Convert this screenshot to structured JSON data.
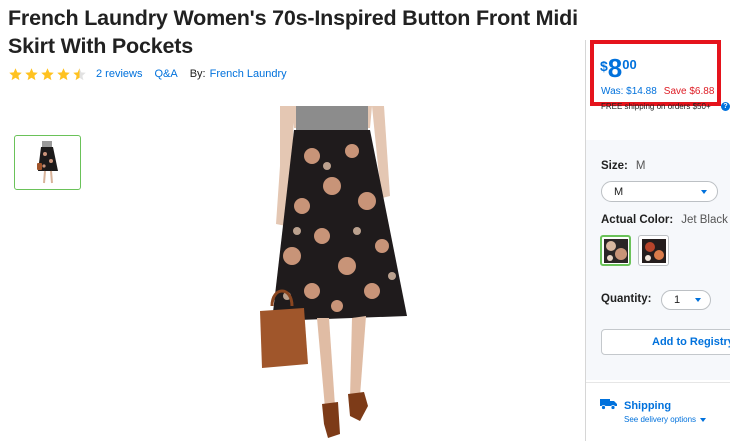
{
  "product": {
    "title": "French Laundry Women's 70s-Inspired Button Front Midi Skirt With Pockets",
    "rating": 4.5,
    "reviews_link": "2 reviews",
    "qa_link": "Q&A",
    "by_label": "By:",
    "brand_link": "French Laundry"
  },
  "price": {
    "currency": "$",
    "whole": "8",
    "cents": "00",
    "was": "Was: $14.88",
    "save": "Save $6.88",
    "free_shipping": "FREE shipping on orders $50+",
    "info_icon": "?"
  },
  "options": {
    "size_label": "Size:",
    "size_value": "M",
    "size_selected": "M",
    "color_label": "Actual Color:",
    "color_value": "Jet Black F",
    "quantity_label": "Quantity:",
    "quantity_selected": "1"
  },
  "actions": {
    "add_to_registry": "Add to Registry"
  },
  "shipping": {
    "title": "Shipping",
    "link": "See delivery options"
  },
  "colors": {
    "accent": "#0071dc",
    "sale_red": "#de1c24",
    "highlight_box": "#e5131c",
    "selected_green": "#6ac259",
    "star": "#ffc220"
  },
  "icons": [
    "star-icon",
    "chevron-down-icon",
    "truck-icon",
    "info-icon"
  ]
}
